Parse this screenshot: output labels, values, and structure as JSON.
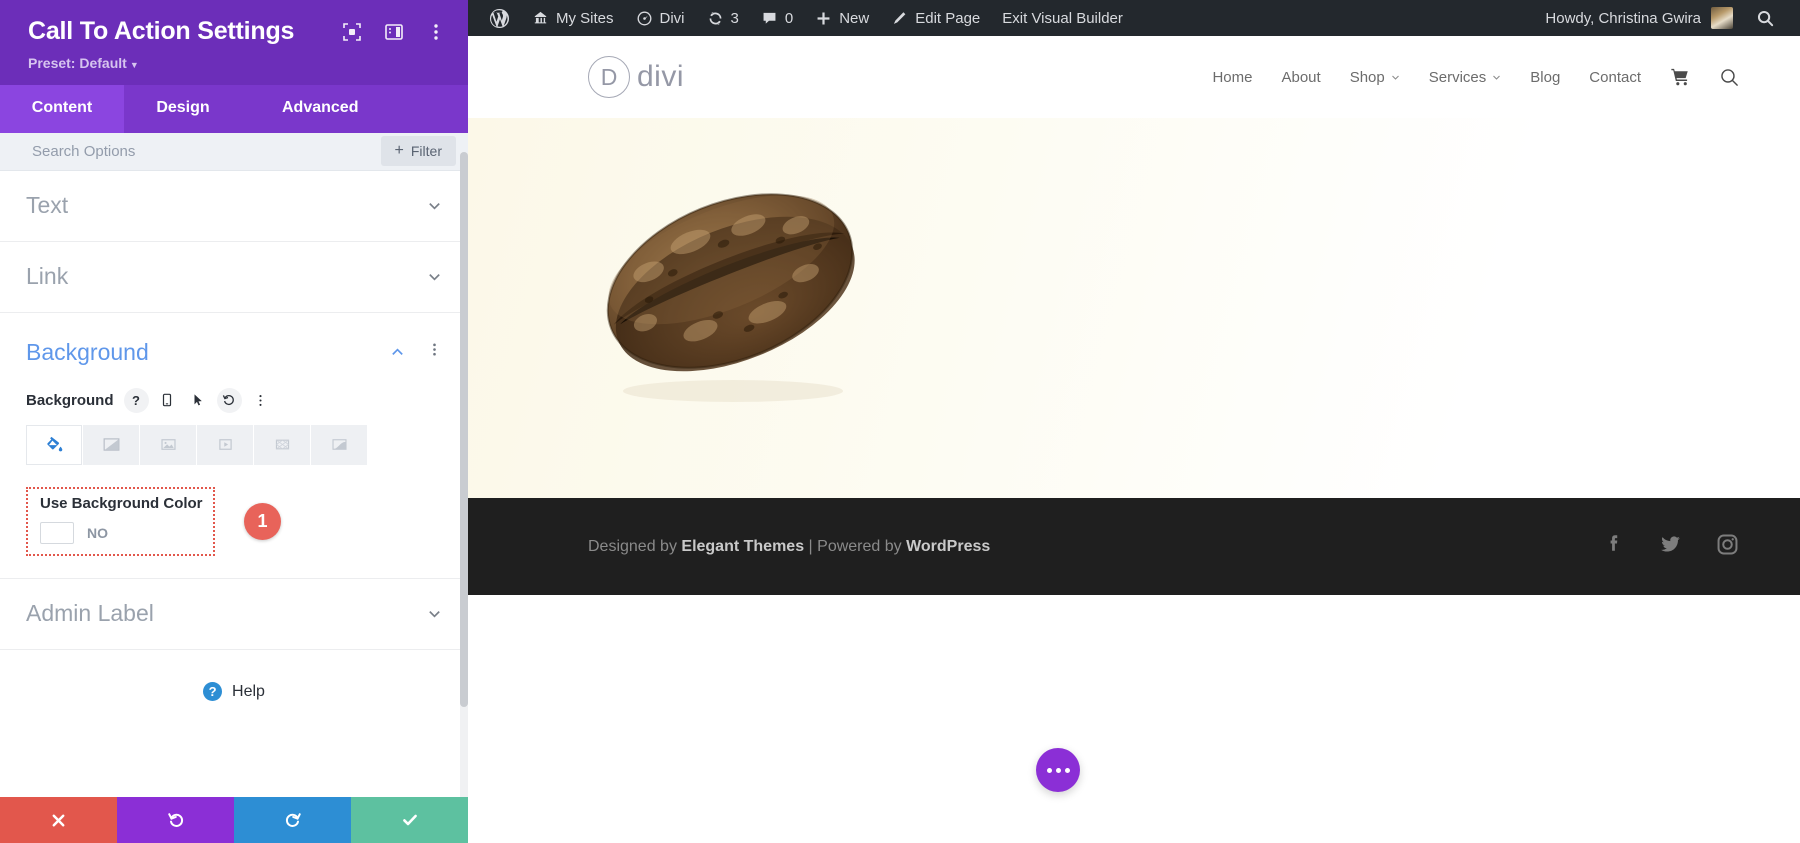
{
  "divi_panel": {
    "title": "Call To Action Settings",
    "preset_label": "Preset: Default",
    "header_icons": [
      {
        "name": "focus-target-icon"
      },
      {
        "name": "panel-layout-icon"
      },
      {
        "name": "vertical-dots-icon"
      }
    ],
    "tabs": [
      {
        "label": "Content",
        "active": true
      },
      {
        "label": "Design",
        "active": false
      },
      {
        "label": "Advanced",
        "active": false
      }
    ],
    "search": {
      "placeholder": "Search Options",
      "value": ""
    },
    "filter_button": {
      "label": "Filter",
      "plus": "+"
    },
    "sections": [
      {
        "label": "Text",
        "state": "collapsed"
      },
      {
        "label": "Link",
        "state": "collapsed"
      }
    ],
    "background_section": {
      "title": "Background",
      "state": "expanded",
      "field_label": "Background",
      "field_controls": [
        {
          "name": "help-icon",
          "glyph": "?"
        },
        {
          "name": "mobile-responsive-icon"
        },
        {
          "name": "hover-cursor-icon"
        },
        {
          "name": "reset-undo-icon"
        },
        {
          "name": "more-options-dots-icon"
        }
      ],
      "background_types": [
        {
          "name": "background-color-icon",
          "active": true
        },
        {
          "name": "background-gradient-icon",
          "active": false
        },
        {
          "name": "background-image-icon",
          "active": false
        },
        {
          "name": "background-video-icon",
          "active": false
        },
        {
          "name": "background-pattern-icon",
          "active": false
        },
        {
          "name": "background-mask-icon",
          "active": false
        }
      ],
      "use_background_color": {
        "label": "Use Background Color",
        "toggle_state": "NO",
        "annotation_badge": "1",
        "highlight_color": "#e2574c"
      }
    },
    "admin_label_section": {
      "label": "Admin Label",
      "state": "collapsed"
    },
    "help": {
      "label": "Help",
      "glyph": "?"
    },
    "footer_buttons": [
      {
        "name": "cancel-button",
        "icon": "close-x-icon",
        "color": "#e2574c"
      },
      {
        "name": "undo-button",
        "icon": "undo-arrow-icon",
        "color": "#8b2fd6"
      },
      {
        "name": "redo-button",
        "icon": "redo-arrow-icon",
        "color": "#2d8ed4"
      },
      {
        "name": "save-button",
        "icon": "checkmark-icon",
        "color": "#5dc1a0"
      }
    ]
  },
  "admin_bar": {
    "items": [
      {
        "label": "",
        "icon": "wordpress-logo-icon"
      },
      {
        "label": "My Sites",
        "icon": "sites-house-icon"
      },
      {
        "label": "Divi",
        "icon": "divi-dashboard-icon"
      },
      {
        "label": "3",
        "icon": "updates-refresh-icon"
      },
      {
        "label": "0",
        "icon": "comments-bubble-icon"
      },
      {
        "label": "New",
        "icon": "plus-icon"
      },
      {
        "label": "Edit Page",
        "icon": "pencil-edit-icon"
      },
      {
        "label": "Exit Visual Builder",
        "icon": ""
      }
    ],
    "howdy": "Howdy, Christina Gwira",
    "avatar": "user-avatar",
    "search_icon": "search-icon"
  },
  "site_header": {
    "logo_letter": "D",
    "logo_word": "divi",
    "nav": [
      {
        "label": "Home",
        "has_dropdown": false
      },
      {
        "label": "About",
        "has_dropdown": false
      },
      {
        "label": "Shop",
        "has_dropdown": true
      },
      {
        "label": "Services",
        "has_dropdown": true
      },
      {
        "label": "Blog",
        "has_dropdown": false
      },
      {
        "label": "Contact",
        "has_dropdown": false
      }
    ],
    "cart_icon": "shopping-cart-icon",
    "search_icon": "search-icon"
  },
  "hero": {
    "image": "artisan-bread-loaf-photo"
  },
  "site_footer": {
    "designed_by_prefix": "Designed by ",
    "designed_by_brand": "Elegant Themes",
    "separator": " | ",
    "powered_by_prefix": "Powered by ",
    "powered_by_brand": "WordPress",
    "social": [
      {
        "name": "facebook-icon"
      },
      {
        "name": "twitter-icon"
      },
      {
        "name": "instagram-icon"
      }
    ]
  },
  "floating_button": {
    "name": "visual-builder-menu-button",
    "icon": "three-dots-icon"
  }
}
